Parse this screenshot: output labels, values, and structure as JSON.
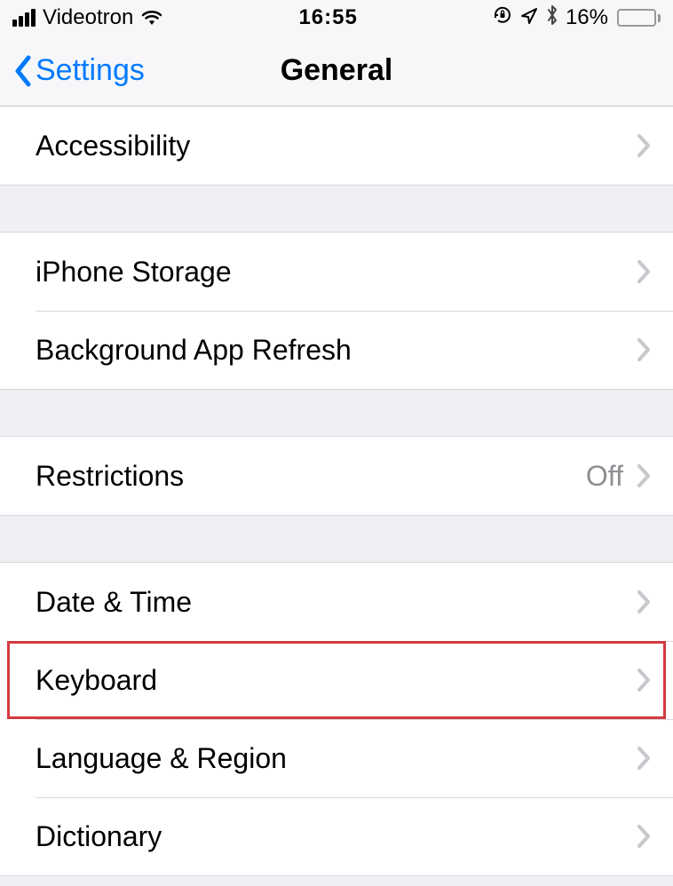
{
  "statusBar": {
    "carrier": "Videotron",
    "time": "16:55",
    "batteryPercent": "16%"
  },
  "nav": {
    "back": "Settings",
    "title": "General"
  },
  "groups": [
    {
      "cells": [
        {
          "label": "Accessibility",
          "value": "",
          "highlighted": false
        }
      ]
    },
    {
      "cells": [
        {
          "label": "iPhone Storage",
          "value": "",
          "highlighted": false
        },
        {
          "label": "Background App Refresh",
          "value": "",
          "highlighted": false
        }
      ]
    },
    {
      "cells": [
        {
          "label": "Restrictions",
          "value": "Off",
          "highlighted": false
        }
      ]
    },
    {
      "cells": [
        {
          "label": "Date & Time",
          "value": "",
          "highlighted": false
        },
        {
          "label": "Keyboard",
          "value": "",
          "highlighted": true
        },
        {
          "label": "Language & Region",
          "value": "",
          "highlighted": false
        },
        {
          "label": "Dictionary",
          "value": "",
          "highlighted": false
        }
      ]
    }
  ]
}
